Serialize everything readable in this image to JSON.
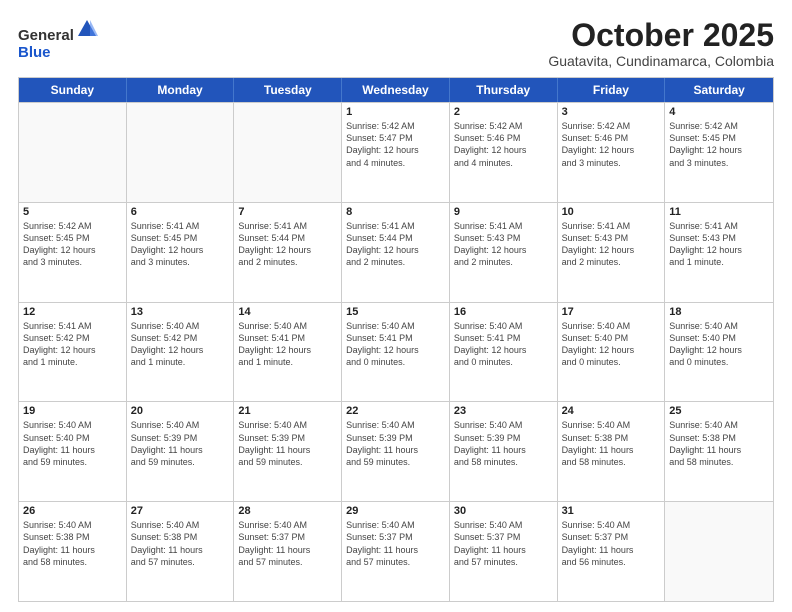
{
  "logo": {
    "general": "General",
    "blue": "Blue"
  },
  "title": "October 2025",
  "location": "Guatavita, Cundinamarca, Colombia",
  "days": [
    "Sunday",
    "Monday",
    "Tuesday",
    "Wednesday",
    "Thursday",
    "Friday",
    "Saturday"
  ],
  "rows": [
    [
      {
        "day": "",
        "text": "",
        "empty": true
      },
      {
        "day": "",
        "text": "",
        "empty": true
      },
      {
        "day": "",
        "text": "",
        "empty": true
      },
      {
        "day": "1",
        "text": "Sunrise: 5:42 AM\nSunset: 5:47 PM\nDaylight: 12 hours\nand 4 minutes.",
        "empty": false
      },
      {
        "day": "2",
        "text": "Sunrise: 5:42 AM\nSunset: 5:46 PM\nDaylight: 12 hours\nand 4 minutes.",
        "empty": false
      },
      {
        "day": "3",
        "text": "Sunrise: 5:42 AM\nSunset: 5:46 PM\nDaylight: 12 hours\nand 3 minutes.",
        "empty": false
      },
      {
        "day": "4",
        "text": "Sunrise: 5:42 AM\nSunset: 5:45 PM\nDaylight: 12 hours\nand 3 minutes.",
        "empty": false
      }
    ],
    [
      {
        "day": "5",
        "text": "Sunrise: 5:42 AM\nSunset: 5:45 PM\nDaylight: 12 hours\nand 3 minutes.",
        "empty": false
      },
      {
        "day": "6",
        "text": "Sunrise: 5:41 AM\nSunset: 5:45 PM\nDaylight: 12 hours\nand 3 minutes.",
        "empty": false
      },
      {
        "day": "7",
        "text": "Sunrise: 5:41 AM\nSunset: 5:44 PM\nDaylight: 12 hours\nand 2 minutes.",
        "empty": false
      },
      {
        "day": "8",
        "text": "Sunrise: 5:41 AM\nSunset: 5:44 PM\nDaylight: 12 hours\nand 2 minutes.",
        "empty": false
      },
      {
        "day": "9",
        "text": "Sunrise: 5:41 AM\nSunset: 5:43 PM\nDaylight: 12 hours\nand 2 minutes.",
        "empty": false
      },
      {
        "day": "10",
        "text": "Sunrise: 5:41 AM\nSunset: 5:43 PM\nDaylight: 12 hours\nand 2 minutes.",
        "empty": false
      },
      {
        "day": "11",
        "text": "Sunrise: 5:41 AM\nSunset: 5:43 PM\nDaylight: 12 hours\nand 1 minute.",
        "empty": false
      }
    ],
    [
      {
        "day": "12",
        "text": "Sunrise: 5:41 AM\nSunset: 5:42 PM\nDaylight: 12 hours\nand 1 minute.",
        "empty": false
      },
      {
        "day": "13",
        "text": "Sunrise: 5:40 AM\nSunset: 5:42 PM\nDaylight: 12 hours\nand 1 minute.",
        "empty": false
      },
      {
        "day": "14",
        "text": "Sunrise: 5:40 AM\nSunset: 5:41 PM\nDaylight: 12 hours\nand 1 minute.",
        "empty": false
      },
      {
        "day": "15",
        "text": "Sunrise: 5:40 AM\nSunset: 5:41 PM\nDaylight: 12 hours\nand 0 minutes.",
        "empty": false
      },
      {
        "day": "16",
        "text": "Sunrise: 5:40 AM\nSunset: 5:41 PM\nDaylight: 12 hours\nand 0 minutes.",
        "empty": false
      },
      {
        "day": "17",
        "text": "Sunrise: 5:40 AM\nSunset: 5:40 PM\nDaylight: 12 hours\nand 0 minutes.",
        "empty": false
      },
      {
        "day": "18",
        "text": "Sunrise: 5:40 AM\nSunset: 5:40 PM\nDaylight: 12 hours\nand 0 minutes.",
        "empty": false
      }
    ],
    [
      {
        "day": "19",
        "text": "Sunrise: 5:40 AM\nSunset: 5:40 PM\nDaylight: 11 hours\nand 59 minutes.",
        "empty": false
      },
      {
        "day": "20",
        "text": "Sunrise: 5:40 AM\nSunset: 5:39 PM\nDaylight: 11 hours\nand 59 minutes.",
        "empty": false
      },
      {
        "day": "21",
        "text": "Sunrise: 5:40 AM\nSunset: 5:39 PM\nDaylight: 11 hours\nand 59 minutes.",
        "empty": false
      },
      {
        "day": "22",
        "text": "Sunrise: 5:40 AM\nSunset: 5:39 PM\nDaylight: 11 hours\nand 59 minutes.",
        "empty": false
      },
      {
        "day": "23",
        "text": "Sunrise: 5:40 AM\nSunset: 5:39 PM\nDaylight: 11 hours\nand 58 minutes.",
        "empty": false
      },
      {
        "day": "24",
        "text": "Sunrise: 5:40 AM\nSunset: 5:38 PM\nDaylight: 11 hours\nand 58 minutes.",
        "empty": false
      },
      {
        "day": "25",
        "text": "Sunrise: 5:40 AM\nSunset: 5:38 PM\nDaylight: 11 hours\nand 58 minutes.",
        "empty": false
      }
    ],
    [
      {
        "day": "26",
        "text": "Sunrise: 5:40 AM\nSunset: 5:38 PM\nDaylight: 11 hours\nand 58 minutes.",
        "empty": false
      },
      {
        "day": "27",
        "text": "Sunrise: 5:40 AM\nSunset: 5:38 PM\nDaylight: 11 hours\nand 57 minutes.",
        "empty": false
      },
      {
        "day": "28",
        "text": "Sunrise: 5:40 AM\nSunset: 5:37 PM\nDaylight: 11 hours\nand 57 minutes.",
        "empty": false
      },
      {
        "day": "29",
        "text": "Sunrise: 5:40 AM\nSunset: 5:37 PM\nDaylight: 11 hours\nand 57 minutes.",
        "empty": false
      },
      {
        "day": "30",
        "text": "Sunrise: 5:40 AM\nSunset: 5:37 PM\nDaylight: 11 hours\nand 57 minutes.",
        "empty": false
      },
      {
        "day": "31",
        "text": "Sunrise: 5:40 AM\nSunset: 5:37 PM\nDaylight: 11 hours\nand 56 minutes.",
        "empty": false
      },
      {
        "day": "",
        "text": "",
        "empty": true
      }
    ]
  ]
}
